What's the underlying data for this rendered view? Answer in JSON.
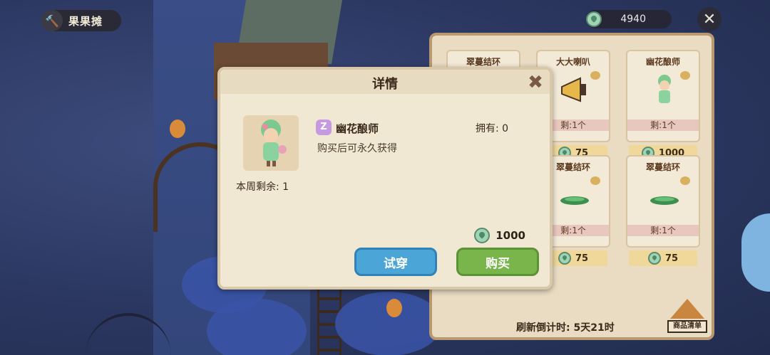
{
  "top_bar": {
    "stall_icon": "wrench-icon",
    "stall_name": "果果摊",
    "currency_icon": "leaf-coin-icon",
    "currency_value": "4940",
    "close_icon": "close-icon"
  },
  "shop": {
    "cards": [
      {
        "title": "翠蔓结环",
        "stock": "",
        "price": ""
      },
      {
        "title": "大大喇叭",
        "stock": "剩:1个",
        "price": "75"
      },
      {
        "title": "幽花酿师",
        "stock": "剩:1个",
        "price": "1000"
      },
      {
        "title": "",
        "stock": "",
        "price": ""
      },
      {
        "title": "翠蔓结环",
        "stock": "剩:1个",
        "price": "75"
      },
      {
        "title": "翠蔓结环",
        "stock": "剩:1个",
        "price": "75"
      }
    ],
    "refresh_text": "刷新倒计时: 5天21时",
    "goods_list_label": "商品清单"
  },
  "dialog": {
    "title": "详情",
    "close_icon": "close-icon",
    "item_badge": "Z",
    "item_name": "幽花酿师",
    "item_desc": "购买后可永久获得",
    "owned": "拥有: 0",
    "weekly_stock": "本周剩余: 1",
    "price": "1000",
    "try_label": "试穿",
    "buy_label": "购买"
  },
  "colors": {
    "try_button": "#4ba6d7",
    "buy_button": "#79b54a",
    "panel": "#f1e8d4"
  }
}
